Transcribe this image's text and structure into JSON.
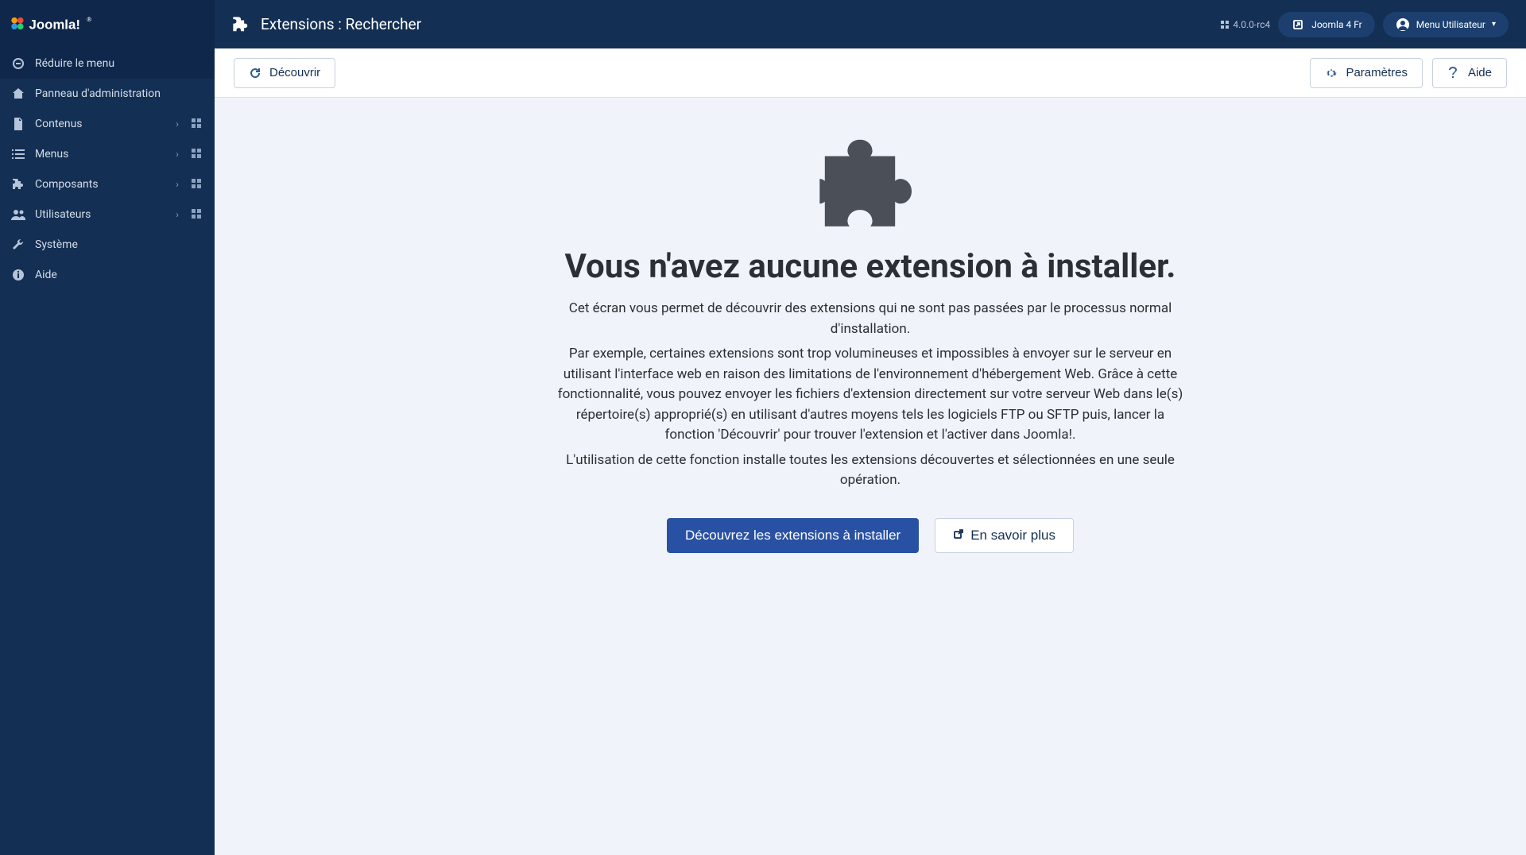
{
  "sidebar": {
    "collapse_label": "Réduire le menu",
    "items": [
      {
        "label": "Panneau d'administration",
        "icon": "home"
      },
      {
        "label": "Contenus",
        "icon": "file",
        "expandable": true,
        "dashboard": true
      },
      {
        "label": "Menus",
        "icon": "list",
        "expandable": true,
        "dashboard": true
      },
      {
        "label": "Composants",
        "icon": "puzzle",
        "expandable": true,
        "dashboard": true
      },
      {
        "label": "Utilisateurs",
        "icon": "users",
        "expandable": true,
        "dashboard": true
      },
      {
        "label": "Système",
        "icon": "wrench"
      },
      {
        "label": "Aide",
        "icon": "info"
      }
    ]
  },
  "header": {
    "title": "Extensions : Rechercher",
    "version": "4.0.0-rc4",
    "site_link": "Joomla 4 Fr",
    "user_menu": "Menu Utilisateur"
  },
  "toolbar": {
    "discover": "Découvrir",
    "options": "Paramètres",
    "help": "Aide"
  },
  "empty": {
    "heading": "Vous n'avez aucune extension à installer.",
    "p1": "Cet écran vous permet de découvrir des extensions qui ne sont pas passées par le processus normal d'installation.",
    "p2": "Par exemple, certaines extensions sont trop volumineuses et impossibles à envoyer sur le serveur en utilisant l'interface web en raison des limitations de l'environnement d'hébergement Web. Grâce à cette fonctionnalité, vous pouvez envoyer les fichiers d'extension directement sur votre serveur Web dans le(s) répertoire(s) approprié(s) en utilisant d'autres moyens tels les logiciels FTP ou SFTP puis, lancer la fonction 'Découvrir' pour trouver l'extension et l'activer dans Joomla!.",
    "p3": "L'utilisation de cette fonction installe toutes les extensions découvertes et sélectionnées en une seule opération.",
    "primary_btn": "Découvrez les extensions à installer",
    "secondary_btn": "En savoir plus"
  }
}
